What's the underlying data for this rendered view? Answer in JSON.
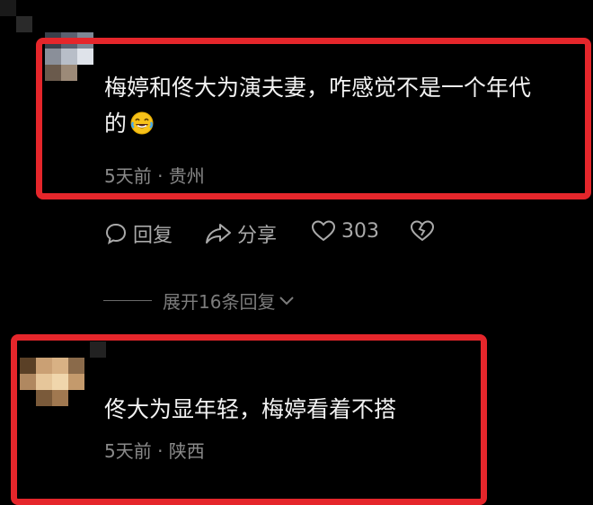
{
  "comments": [
    {
      "text_line1": "梅婷和佟大为演夫妻，咋感觉不是一个年代",
      "text_line2": "的",
      "emoji": "laughing-tears-emoji",
      "meta": "5天前 · 贵州",
      "actions": {
        "reply_label": "回复",
        "share_label": "分享",
        "like_count": "303"
      },
      "expand_label": "展开16条回复"
    },
    {
      "text": "佟大为显年轻，梅婷看着不搭",
      "meta": "5天前 · 陕西"
    }
  ],
  "colors": {
    "highlight": "#e5262b",
    "background": "#000000",
    "meta_text": "#8a8a8a",
    "action_text": "#a9a9a9"
  },
  "icons": [
    "reply-bubble-icon",
    "share-arrow-icon",
    "heart-icon",
    "broken-heart-icon",
    "chevron-down-icon"
  ]
}
